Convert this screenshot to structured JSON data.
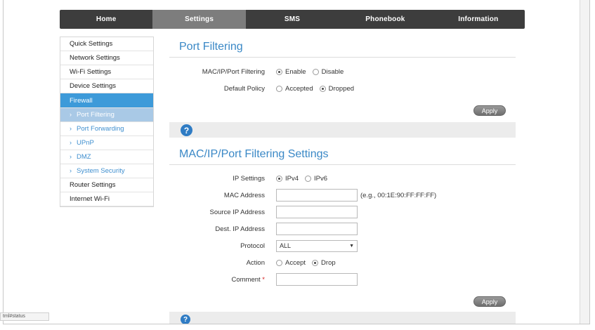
{
  "nav": {
    "tabs": [
      {
        "label": "Home",
        "active": false
      },
      {
        "label": "Settings",
        "active": true
      },
      {
        "label": "SMS",
        "active": false
      },
      {
        "label": "Phonebook",
        "active": false
      },
      {
        "label": "Information",
        "active": false
      }
    ]
  },
  "sidebar": {
    "items": [
      {
        "label": "Quick Settings",
        "type": "item"
      },
      {
        "label": "Network Settings",
        "type": "item"
      },
      {
        "label": "Wi-Fi Settings",
        "type": "item"
      },
      {
        "label": "Device Settings",
        "type": "item"
      },
      {
        "label": "Firewall",
        "type": "group"
      },
      {
        "label": "Port Filtering",
        "type": "sub",
        "selected": true
      },
      {
        "label": "Port Forwarding",
        "type": "sub"
      },
      {
        "label": "UPnP",
        "type": "sub"
      },
      {
        "label": "DMZ",
        "type": "sub"
      },
      {
        "label": "System Security",
        "type": "sub"
      },
      {
        "label": "Router Settings",
        "type": "item"
      },
      {
        "label": "Internet Wi-Fi",
        "type": "item"
      }
    ]
  },
  "port_filtering": {
    "title": "Port Filtering",
    "filter_label": "MAC/IP/Port Filtering",
    "enable_label": "Enable",
    "disable_label": "Disable",
    "policy_label": "Default Policy",
    "accepted_label": "Accepted",
    "dropped_label": "Dropped",
    "apply_label": "Apply"
  },
  "help": {
    "icon": "help-icon",
    "glyph": "?"
  },
  "settings": {
    "title": "MAC/IP/Port Filtering Settings",
    "ip_label": "IP Settings",
    "ipv4_label": "IPv4",
    "ipv6_label": "IPv6",
    "mac_label": "MAC Address",
    "mac_value": "",
    "mac_hint": "(e.g., 00:1E:90:FF:FF:FF)",
    "source_ip_label": "Source IP Address",
    "source_ip_value": "",
    "dest_ip_label": "Dest. IP Address",
    "dest_ip_value": "",
    "protocol_label": "Protocol",
    "protocol_value": "ALL",
    "action_label": "Action",
    "accept_label": "Accept",
    "drop_label": "Drop",
    "comment_label": "Comment",
    "required_mark": "*",
    "comment_value": "",
    "apply_label": "Apply"
  },
  "status": {
    "text": "tml#status"
  },
  "colors": {
    "accent": "#3a88c6",
    "nav_bg": "#3d3d3d",
    "nav_active": "#7d7d7d",
    "sidebar_group": "#3d9ad9"
  }
}
